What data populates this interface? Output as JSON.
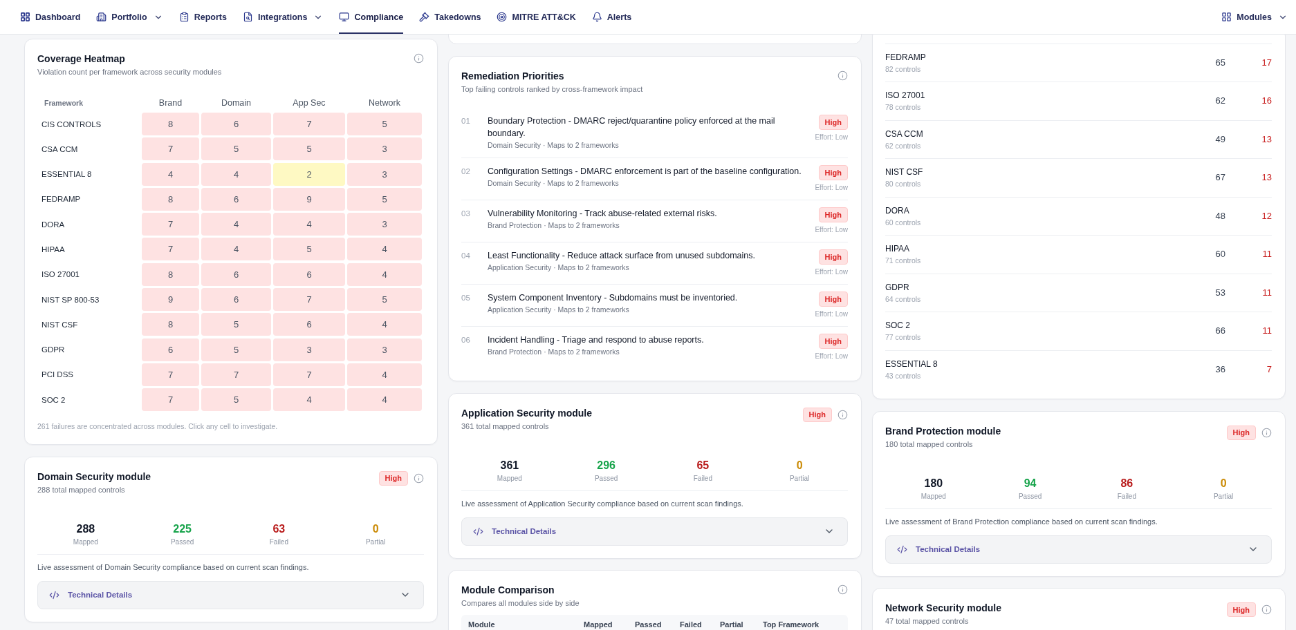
{
  "nav": {
    "tabs": [
      {
        "label": "Dashboard",
        "dropdown": false,
        "selected": false
      },
      {
        "label": "Portfolio",
        "dropdown": true,
        "selected": false
      },
      {
        "label": "Reports",
        "dropdown": false,
        "selected": false
      },
      {
        "label": "Integrations",
        "dropdown": true,
        "selected": false
      },
      {
        "label": "Compliance",
        "dropdown": false,
        "selected": true
      },
      {
        "label": "Takedowns",
        "dropdown": false,
        "selected": false
      },
      {
        "label": "MITRE ATT&CK",
        "dropdown": false,
        "selected": false
      },
      {
        "label": "Alerts",
        "dropdown": false,
        "selected": false
      }
    ],
    "modules_menu": {
      "label": "Modules",
      "dropdown": true
    }
  },
  "coverage_heatmap": {
    "title": "Coverage Heatmap",
    "subtitle": "Violation count per framework across security modules",
    "framework_header": "Framework",
    "columns": [
      "Brand",
      "Domain",
      "App Sec",
      "Network"
    ],
    "rows": [
      {
        "framework": "CIS CONTROLS",
        "cells": [
          {
            "value": "8",
            "color": "#fee2e2"
          },
          {
            "value": "6",
            "color": "#fee2e2"
          },
          {
            "value": "7",
            "color": "#fee2e2"
          },
          {
            "value": "5",
            "color": "#fee2e2"
          }
        ]
      },
      {
        "framework": "CSA CCM",
        "cells": [
          {
            "value": "7",
            "color": "#fee2e2"
          },
          {
            "value": "5",
            "color": "#fee2e2"
          },
          {
            "value": "5",
            "color": "#fee2e2"
          },
          {
            "value": "3",
            "color": "#fee2e2"
          }
        ]
      },
      {
        "framework": "ESSENTIAL 8",
        "cells": [
          {
            "value": "4",
            "color": "#fee2e2"
          },
          {
            "value": "4",
            "color": "#fee2e2"
          },
          {
            "value": "2",
            "color": "#fef9c3"
          },
          {
            "value": "3",
            "color": "#fee2e2"
          }
        ]
      },
      {
        "framework": "FEDRAMP",
        "cells": [
          {
            "value": "8",
            "color": "#fee2e2"
          },
          {
            "value": "6",
            "color": "#fee2e2"
          },
          {
            "value": "9",
            "color": "#fee2e2"
          },
          {
            "value": "5",
            "color": "#fee2e2"
          }
        ]
      },
      {
        "framework": "DORA",
        "cells": [
          {
            "value": "7",
            "color": "#fee2e2"
          },
          {
            "value": "4",
            "color": "#fee2e2"
          },
          {
            "value": "4",
            "color": "#fee2e2"
          },
          {
            "value": "3",
            "color": "#fee2e2"
          }
        ]
      },
      {
        "framework": "HIPAA",
        "cells": [
          {
            "value": "7",
            "color": "#fee2e2"
          },
          {
            "value": "4",
            "color": "#fee2e2"
          },
          {
            "value": "5",
            "color": "#fee2e2"
          },
          {
            "value": "4",
            "color": "#fee2e2"
          }
        ]
      },
      {
        "framework": "ISO 27001",
        "cells": [
          {
            "value": "8",
            "color": "#fee2e2"
          },
          {
            "value": "6",
            "color": "#fee2e2"
          },
          {
            "value": "6",
            "color": "#fee2e2"
          },
          {
            "value": "4",
            "color": "#fee2e2"
          }
        ]
      },
      {
        "framework": "NIST SP 800-53",
        "cells": [
          {
            "value": "9",
            "color": "#fee2e2"
          },
          {
            "value": "6",
            "color": "#fee2e2"
          },
          {
            "value": "7",
            "color": "#fee2e2"
          },
          {
            "value": "5",
            "color": "#fee2e2"
          }
        ]
      },
      {
        "framework": "NIST CSF",
        "cells": [
          {
            "value": "8",
            "color": "#fee2e2"
          },
          {
            "value": "5",
            "color": "#fee2e2"
          },
          {
            "value": "6",
            "color": "#fee2e2"
          },
          {
            "value": "4",
            "color": "#fee2e2"
          }
        ]
      },
      {
        "framework": "GDPR",
        "cells": [
          {
            "value": "6",
            "color": "#fee2e2"
          },
          {
            "value": "5",
            "color": "#fee2e2"
          },
          {
            "value": "3",
            "color": "#fee2e2"
          },
          {
            "value": "3",
            "color": "#fee2e2"
          }
        ]
      },
      {
        "framework": "PCI DSS",
        "cells": [
          {
            "value": "7",
            "color": "#fee2e2"
          },
          {
            "value": "7",
            "color": "#fee2e2"
          },
          {
            "value": "7",
            "color": "#fee2e2"
          },
          {
            "value": "4",
            "color": "#fee2e2"
          }
        ]
      },
      {
        "framework": "SOC 2",
        "cells": [
          {
            "value": "7",
            "color": "#fee2e2"
          },
          {
            "value": "5",
            "color": "#fee2e2"
          },
          {
            "value": "4",
            "color": "#fee2e2"
          },
          {
            "value": "4",
            "color": "#fee2e2"
          }
        ]
      }
    ],
    "footnote": "261 failures are concentrated across modules. Click any cell to investigate."
  },
  "remediation": {
    "title": "Remediation Priorities",
    "subtitle": "Top failing controls ranked by cross-framework impact",
    "items": [
      {
        "rank": "01",
        "title": "Boundary Protection - DMARC reject/quarantine policy enforced at the mail boundary.",
        "meta": "Domain Security · Maps to 2 frameworks",
        "severity": "High",
        "effort": "Effort: Low"
      },
      {
        "rank": "02",
        "title": "Configuration Settings - DMARC enforcement is part of the baseline configuration.",
        "meta": "Domain Security · Maps to 2 frameworks",
        "severity": "High",
        "effort": "Effort: Low"
      },
      {
        "rank": "03",
        "title": "Vulnerability Monitoring - Track abuse-related external risks.",
        "meta": "Brand Protection · Maps to 2 frameworks",
        "severity": "High",
        "effort": "Effort: Low"
      },
      {
        "rank": "04",
        "title": "Least Functionality - Reduce attack surface from unused subdomains.",
        "meta": "Application Security · Maps to 2 frameworks",
        "severity": "High",
        "effort": "Effort: Low"
      },
      {
        "rank": "05",
        "title": "System Component Inventory - Subdomains must be inventoried.",
        "meta": "Application Security · Maps to 2 frameworks",
        "severity": "High",
        "effort": "Effort: Low"
      },
      {
        "rank": "06",
        "title": "Incident Handling - Triage and respond to abuse reports.",
        "meta": "Brand Protection · Maps to 2 frameworks",
        "severity": "High",
        "effort": "Effort: Low"
      }
    ]
  },
  "framework_totals": {
    "rows": [
      {
        "name": "FEDRAMP",
        "controls": "82 controls",
        "column_2": "65",
        "column_3": "17"
      },
      {
        "name": "ISO 27001",
        "controls": "78 controls",
        "column_2": "62",
        "column_3": "16"
      },
      {
        "name": "CSA CCM",
        "controls": "62 controls",
        "column_2": "49",
        "column_3": "13"
      },
      {
        "name": "NIST CSF",
        "controls": "80 controls",
        "column_2": "67",
        "column_3": "13"
      },
      {
        "name": "DORA",
        "controls": "60 controls",
        "column_2": "48",
        "column_3": "12"
      },
      {
        "name": "HIPAA",
        "controls": "71 controls",
        "column_2": "60",
        "column_3": "11"
      },
      {
        "name": "GDPR",
        "controls": "64 controls",
        "column_2": "53",
        "column_3": "11"
      },
      {
        "name": "SOC 2",
        "controls": "77 controls",
        "column_2": "66",
        "column_3": "11"
      },
      {
        "name": "ESSENTIAL 8",
        "controls": "43 controls",
        "column_2": "36",
        "column_3": "7"
      }
    ]
  },
  "modules": [
    {
      "title": "Domain Security module",
      "subtitle": "288 total mapped controls",
      "severity": "High",
      "stats": [
        {
          "kind": "mapped",
          "value": "288",
          "label": "Mapped"
        },
        {
          "kind": "passed",
          "value": "225",
          "label": "Passed"
        },
        {
          "kind": "failed",
          "value": "63",
          "label": "Failed"
        },
        {
          "kind": "partial",
          "value": "0",
          "label": "Partial"
        }
      ],
      "description": "Live assessment of Domain Security compliance based on current scan findings.",
      "details_label": "Technical Details",
      "expanded": false
    },
    {
      "title": "Application Security module",
      "subtitle": "361 total mapped controls",
      "severity": "High",
      "stats": [
        {
          "kind": "mapped",
          "value": "361",
          "label": "Mapped"
        },
        {
          "kind": "passed",
          "value": "296",
          "label": "Passed"
        },
        {
          "kind": "failed",
          "value": "65",
          "label": "Failed"
        },
        {
          "kind": "partial",
          "value": "0",
          "label": "Partial"
        }
      ],
      "description": "Live assessment of Application Security compliance based on current scan findings.",
      "details_label": "Technical Details",
      "expanded": false
    },
    {
      "title": "Brand Protection module",
      "subtitle": "180 total mapped controls",
      "severity": "High",
      "stats": [
        {
          "kind": "mapped",
          "value": "180",
          "label": "Mapped"
        },
        {
          "kind": "passed",
          "value": "94",
          "label": "Passed"
        },
        {
          "kind": "failed",
          "value": "86",
          "label": "Failed"
        },
        {
          "kind": "partial",
          "value": "0",
          "label": "Partial"
        }
      ],
      "description": "Live assessment of Brand Protection compliance based on current scan findings.",
      "details_label": "Technical Details",
      "expanded": false
    },
    {
      "title": "Network Security module",
      "subtitle": "47 total mapped controls",
      "severity": "High"
    }
  ],
  "module_comparison": {
    "title": "Module Comparison",
    "subtitle": "Compares all modules side by side",
    "columns": [
      "Module",
      "Mapped",
      "Passed",
      "Failed",
      "Partial",
      "Top Framework"
    ]
  }
}
